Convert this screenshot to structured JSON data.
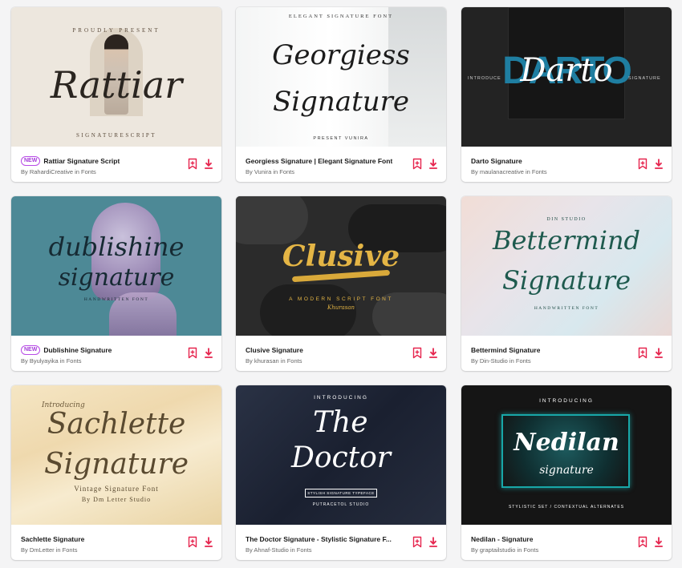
{
  "cards": [
    {
      "title": "Rattiar Signature Script",
      "author": "By RahardiCreative in Fonts",
      "badge": "NEW",
      "preview": {
        "script": "Rattiar",
        "top": "PROUDLY PRESENT",
        "bottom": "SIGNATURESCRIPT"
      }
    },
    {
      "title": "Georgiess Signature | Elegant Signature Font",
      "author": "By Vunira in Fonts",
      "preview": {
        "top": "ELEGANT SIGNATURE FONT",
        "line1": "Georgiess",
        "line2": "Signature",
        "bottom": "PRESENT VUNIRA"
      }
    },
    {
      "title": "Darto Signature",
      "author": "By maulanacreative in Fonts",
      "preview": {
        "block": "DARTO",
        "script": "Darto",
        "left": "INTRODUCE",
        "right": "SIGNATURE"
      }
    },
    {
      "title": "Dublishine Signature",
      "author": "By Byulyayika in Fonts",
      "badge": "NEW",
      "preview": {
        "line1": "dublishine",
        "line2": "signature",
        "bottom": "HANDWRITTEN FONT"
      }
    },
    {
      "title": "Clusive Signature",
      "author": "By khurasan in Fonts",
      "preview": {
        "script": "Clusive",
        "sub": "A MODERN SCRIPT FONT",
        "sign": "Khurasan"
      }
    },
    {
      "title": "Bettermind Signature",
      "author": "By Din-Studio in Fonts",
      "preview": {
        "top": "DIN STUDIO",
        "line1": "Bettermind",
        "line2": "Signature",
        "bottom": "HANDWRITTEN FONT"
      }
    },
    {
      "title": "Sachlette Signature",
      "author": "By DmLetter in Fonts",
      "preview": {
        "intro": "Introducing",
        "line1": "Sachlette",
        "line2": "Signature",
        "sub1": "Vintage Signature Font",
        "sub2": "By Dm Letter Studio"
      }
    },
    {
      "title": "The Doctor Signature - Stylistic Signature F...",
      "author": "By Ahnaf-Studio in Fonts",
      "preview": {
        "top": "INTRODUCING",
        "line1": "The",
        "line2": "Doctor",
        "boxed": "STYLISH SIGNATURE TYPEFACE",
        "bottom": "PUTRACETOL STUDIO"
      }
    },
    {
      "title": "Nedilan - Signature",
      "author": "By graptailstudio in Fonts",
      "preview": {
        "top": "INTRODUCING",
        "line1": "Nedilan",
        "line2": "signature",
        "bottom": "STYLISTIC SET / CONTEXTUAL ALTERNATES"
      }
    }
  ],
  "colors": {
    "accent": "#e6254e",
    "badge": "#a43ad9"
  }
}
